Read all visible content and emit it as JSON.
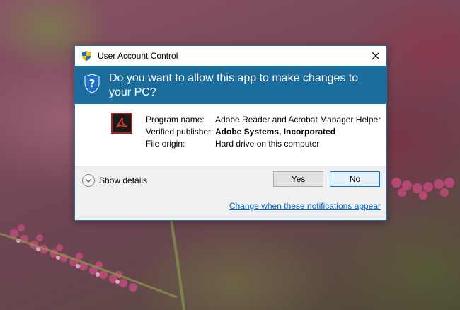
{
  "window": {
    "title": "User Account Control",
    "title_icon": "uac-shield-icon",
    "close_icon": "close-icon"
  },
  "banner": {
    "question": "Do you want to allow this app to make changes to your PC?",
    "icon": "question-shield-icon",
    "color": "#1a6d9c"
  },
  "details": {
    "app_icon": "adobe-acrobat-icon",
    "rows": [
      {
        "label": "Program name:",
        "value": "Adobe Reader and Acrobat Manager Helper"
      },
      {
        "label": "Verified publisher:",
        "value": "Adobe Systems, Incorporated"
      },
      {
        "label": "File origin:",
        "value": "Hard drive on this computer"
      }
    ]
  },
  "actions": {
    "show_details_label": "Show details",
    "yes_label": "Yes",
    "no_label": "No"
  },
  "footer": {
    "link_text": "Change when these notifications appear"
  },
  "colors": {
    "accent": "#0078d7",
    "link": "#0066cc",
    "banner": "#1a6d9c"
  }
}
